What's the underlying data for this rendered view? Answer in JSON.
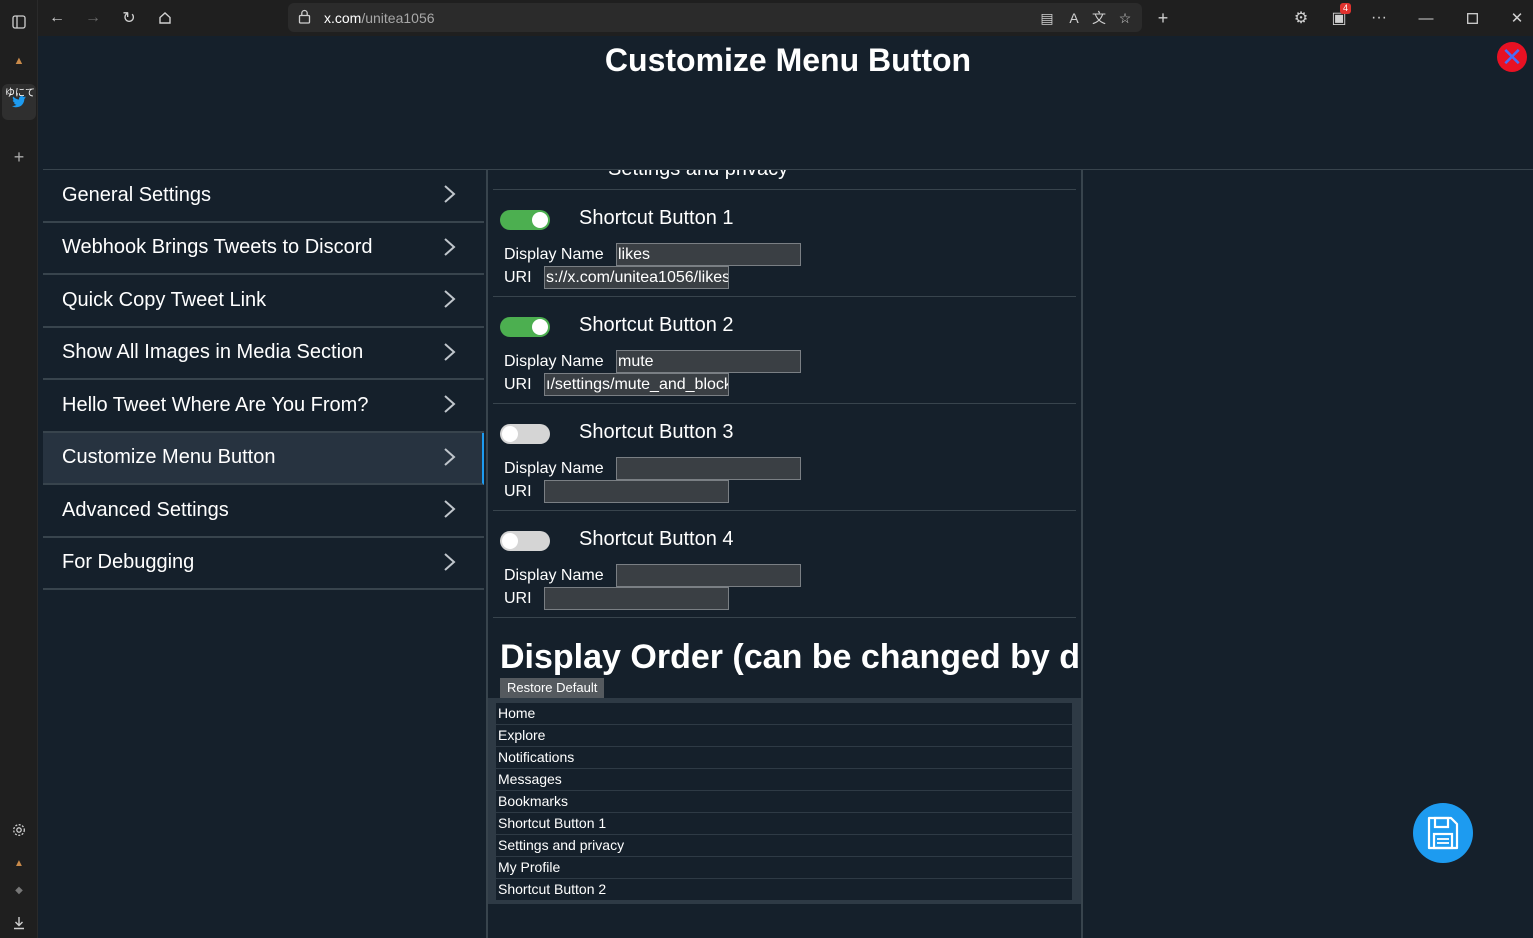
{
  "browser": {
    "url_host": "x.com",
    "url_path": "/unitea1056",
    "extension_badge": "4",
    "tab_label": "ゆにて"
  },
  "page": {
    "title": "Customize Menu Button"
  },
  "sidebar": {
    "items": [
      {
        "label": "General Settings"
      },
      {
        "label": "Webhook Brings Tweets to Discord"
      },
      {
        "label": "Quick Copy Tweet Link"
      },
      {
        "label": "Show All Images in Media Section"
      },
      {
        "label": "Hello Tweet Where Are You From?"
      },
      {
        "label": "Customize Menu Button",
        "active": true
      },
      {
        "label": "Advanced Settings"
      },
      {
        "label": "For Debugging"
      }
    ]
  },
  "content": {
    "cut_off_heading": "Settings and privacy",
    "display_name_label": "Display Name",
    "uri_label": "URI",
    "shortcuts": [
      {
        "title": "Shortcut Button 1",
        "enabled": true,
        "display_name": "likes",
        "uri": "s://x.com/unitea1056/likes"
      },
      {
        "title": "Shortcut Button 2",
        "enabled": true,
        "display_name": "mute",
        "uri": "ı/settings/mute_and_block"
      },
      {
        "title": "Shortcut Button 3",
        "enabled": false,
        "display_name": "",
        "uri": ""
      },
      {
        "title": "Shortcut Button 4",
        "enabled": false,
        "display_name": "",
        "uri": ""
      }
    ],
    "order_title": "Display Order (can be changed by drag)",
    "restore_label": "Restore Default",
    "order_items": [
      "Home",
      "Explore",
      "Notifications",
      "Messages",
      "Bookmarks",
      "Shortcut Button 1",
      "Settings and privacy",
      "My Profile",
      "Shortcut Button 2"
    ]
  },
  "colors": {
    "background": "#15202b",
    "accent": "#1d9bf0",
    "toggle_on": "#4caf50",
    "close": "#e81123"
  },
  "icons": {
    "close": "close-icon",
    "save": "save-icon",
    "chevron": "chevron-right-icon"
  }
}
